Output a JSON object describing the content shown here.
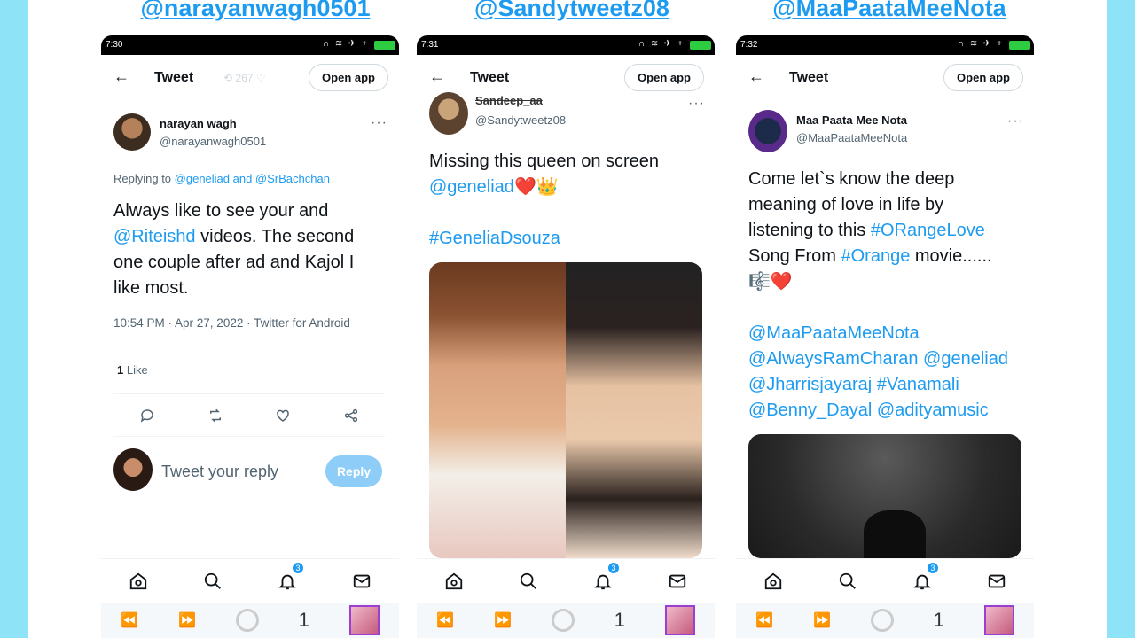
{
  "handles": [
    "@narayanwagh0501",
    "@Sandytweetz08",
    "@MaaPaataMeeNota"
  ],
  "nav": {
    "title": "Tweet",
    "open_app": "Open app"
  },
  "bottom_nav": {
    "badge": "3"
  },
  "sys_nav": {
    "tab_count": "1"
  },
  "phones": [
    {
      "time": "7:30",
      "name": "narayan wagh",
      "username": "@narayanwagh0501",
      "more": "···",
      "replying_prefix": "Replying to ",
      "replying_users": "@geneliad and @SrBachchan",
      "text_l1": "Always like to see  your and",
      "text_l2_link": "@Riteishd",
      "text_l2_rest": " videos. The second",
      "text_l3": "one couple after ad and Kajol I",
      "text_l4": "like most.",
      "meta": "10:54 PM · Apr 27, 2022 · Twitter for Android",
      "likes_count": "1",
      "likes_label": " Like",
      "reply_placeholder": "Tweet your reply",
      "reply_button": "Reply",
      "faded_retweets": "267"
    },
    {
      "time": "7:31",
      "name": "Sandeep_aa",
      "username": "@Sandytweetz08",
      "more": "···",
      "text_l1": "Missing this queen on screen",
      "text_l2_link": "@geneliad",
      "text_l2_emoji": "❤️👑",
      "hashtag": "#GeneliaDsouza"
    },
    {
      "time": "7:32",
      "name": "Maa Paata Mee Nota",
      "username": "@MaaPaataMeeNota",
      "more": "···",
      "text_l1": "Come let`s know the deep",
      "text_l2": "meaning of love in life by",
      "text_l3_pre": "listening to this ",
      "text_l3_link": "#ORangeLove",
      "text_l4_pre": "Song From ",
      "text_l4_link": "#Orange",
      "text_l4_post": " movie......",
      "text_l5_emoji": "🎼❤️",
      "mention_l1": "@MaaPaataMeeNota",
      "mention_l2": "@AlwaysRamCharan @geneliad",
      "mention_l3": "@Jharrisjayaraj #Vanamali",
      "mention_l4": "@Benny_Dayal @adityamusic"
    }
  ]
}
